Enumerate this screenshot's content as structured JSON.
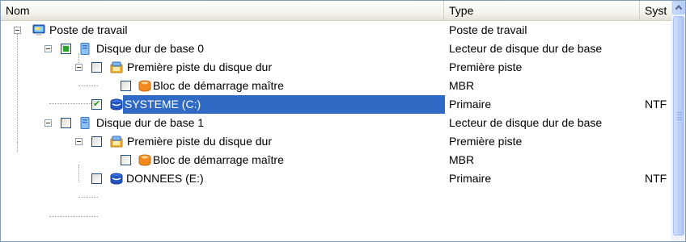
{
  "columns": {
    "name": "Nom",
    "type": "Type",
    "system": "Syst"
  },
  "rows": [
    {
      "name": "Poste de travail",
      "type": "Poste de travail",
      "system": ""
    },
    {
      "name": "Disque dur de base 0",
      "type": "Lecteur de disque dur de base",
      "system": ""
    },
    {
      "name": "Première piste du disque dur",
      "type": "Première piste",
      "system": ""
    },
    {
      "name": "Bloc de démarrage maître",
      "type": "MBR",
      "system": ""
    },
    {
      "name": "SYSTEME (C:)",
      "type": "Primaire",
      "system": "NTF"
    },
    {
      "name": "Disque dur de base 1",
      "type": "Lecteur de disque dur de base",
      "system": ""
    },
    {
      "name": "Première piste du disque dur",
      "type": "Première piste",
      "system": ""
    },
    {
      "name": "Bloc de démarrage maître",
      "type": "MBR",
      "system": ""
    },
    {
      "name": "DONNEES (E:)",
      "type": "Primaire",
      "system": "NTF"
    }
  ],
  "colors": {
    "selection": "#316ac5",
    "header": "#f2f1ea",
    "border": "#7f9db9"
  },
  "icons": [
    "computer-icon",
    "hard-disk-icon",
    "first-track-icon",
    "mbr-icon",
    "partition-icon"
  ]
}
